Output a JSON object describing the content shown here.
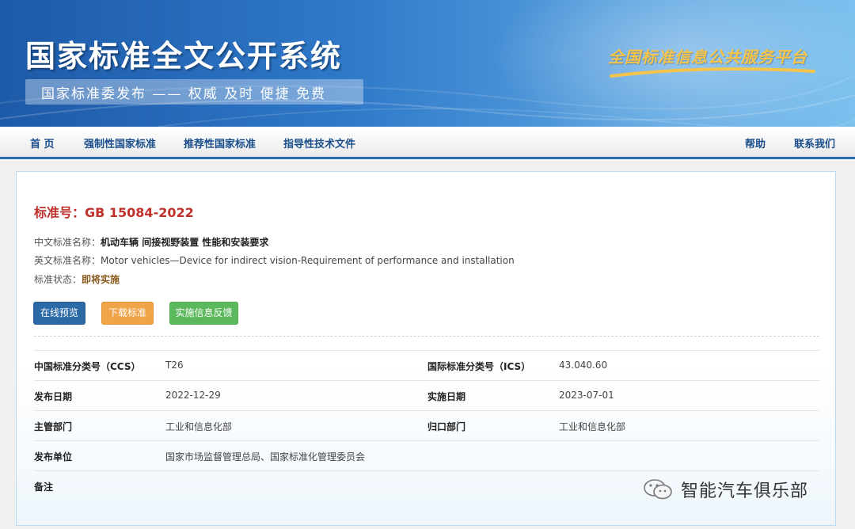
{
  "header": {
    "site_title": "国家标准全文公开系统",
    "subtitle": "国家标准委发布 —— 权威 及时 便捷 免费",
    "slogan": "全国标准信息公共服务平台"
  },
  "nav": {
    "items": [
      "首 页",
      "强制性国家标准",
      "推荐性国家标准",
      "指导性技术文件"
    ],
    "right_items": [
      "帮助",
      "联系我们"
    ]
  },
  "standard": {
    "title": "标准号：GB 15084-2022",
    "cn_name_label": "中文标准名称：",
    "cn_name": "机动车辆 间接视野装置 性能和安装要求",
    "en_name_label": "英文标准名称：",
    "en_name": "Motor vehicles—Device for indirect vision-Requirement of performance and installation",
    "status_label": "标准状态：",
    "status": "即将实施"
  },
  "buttons": {
    "preview": "在线预览",
    "download": "下载标准",
    "feedback": "实施信息反馈"
  },
  "details": {
    "rows": [
      {
        "label1": "中国标准分类号（CCS）",
        "value1": "T26",
        "label2": "国际标准分类号（ICS）",
        "value2": "43.040.60"
      },
      {
        "label1": "发布日期",
        "value1": "2022-12-29",
        "label2": "实施日期",
        "value2": "2023-07-01"
      },
      {
        "label1": "主管部门",
        "value1": "工业和信息化部",
        "label2": "归口部门",
        "value2": "工业和信息化部"
      },
      {
        "label1": "发布单位",
        "value1": "国家市场监督管理总局、国家标准化管理委员会",
        "label2": "",
        "value2": ""
      },
      {
        "label1": "备注",
        "value1": "",
        "label2": "",
        "value2": ""
      }
    ]
  },
  "watermark": {
    "text": "智能汽车俱乐部"
  },
  "colors": {
    "banner_blue": "#2f78c8",
    "nav_text": "#1a4f8b",
    "title_red": "#c0302a",
    "btn_preview": "#2b6aa6",
    "btn_download": "#f0a447",
    "btn_feedback": "#5cb85c"
  }
}
